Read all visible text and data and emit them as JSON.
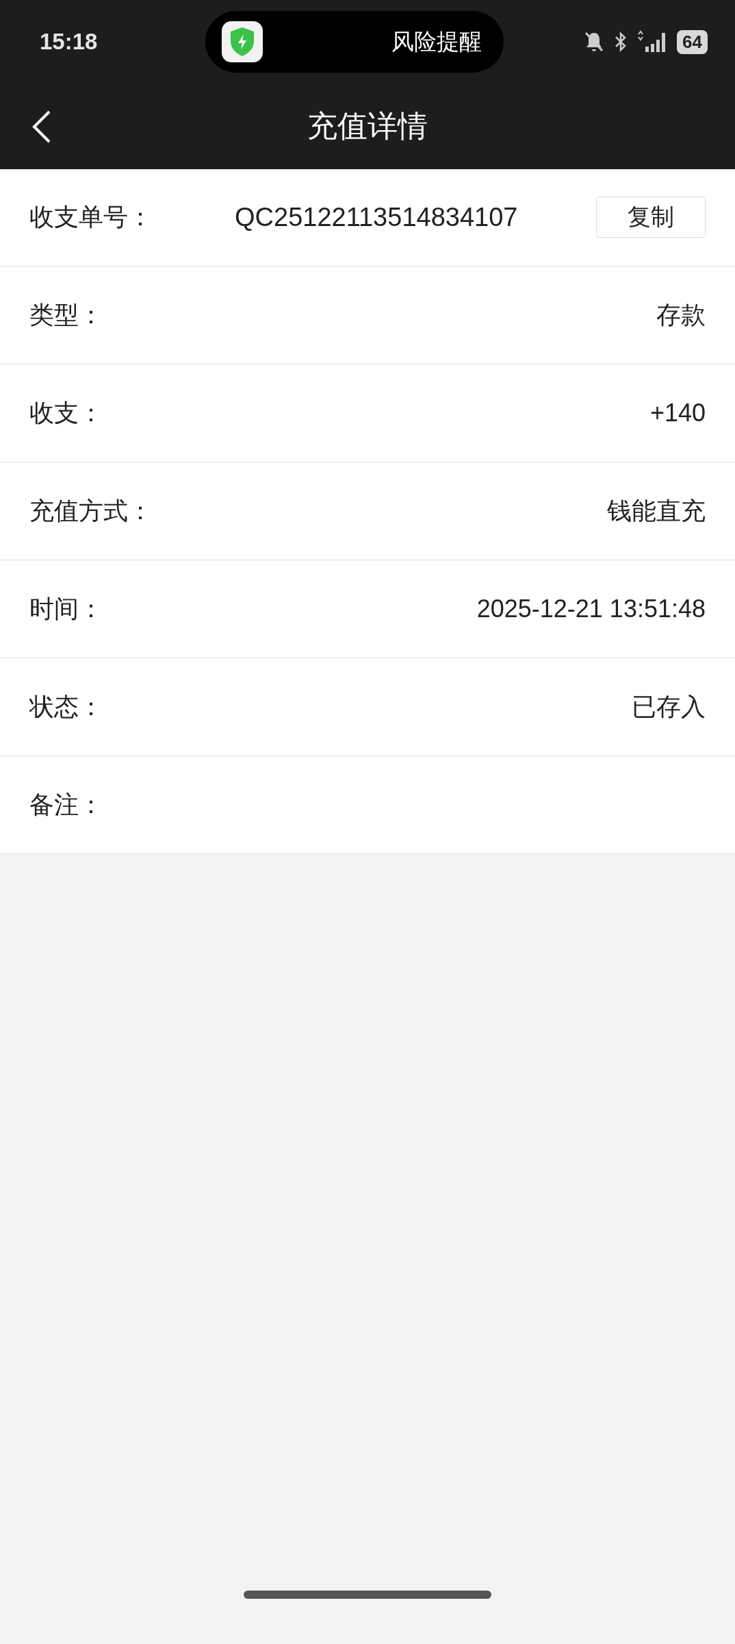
{
  "status_bar": {
    "time": "15:18",
    "notification": "风险提醒",
    "battery": "64"
  },
  "header": {
    "title": "充值详情"
  },
  "order": {
    "label": "收支单号：",
    "value": "QC25122113514834107",
    "button": "复制"
  },
  "rows": [
    {
      "label": "类型：",
      "value": "存款"
    },
    {
      "label": "收支：",
      "value": "+140"
    },
    {
      "label": "充值方式：",
      "value": "钱能直充"
    },
    {
      "label": "时间：",
      "value": "2025-12-21 13:51:48"
    },
    {
      "label": "状态：",
      "value": "已存入"
    },
    {
      "label": "备注："
    }
  ]
}
